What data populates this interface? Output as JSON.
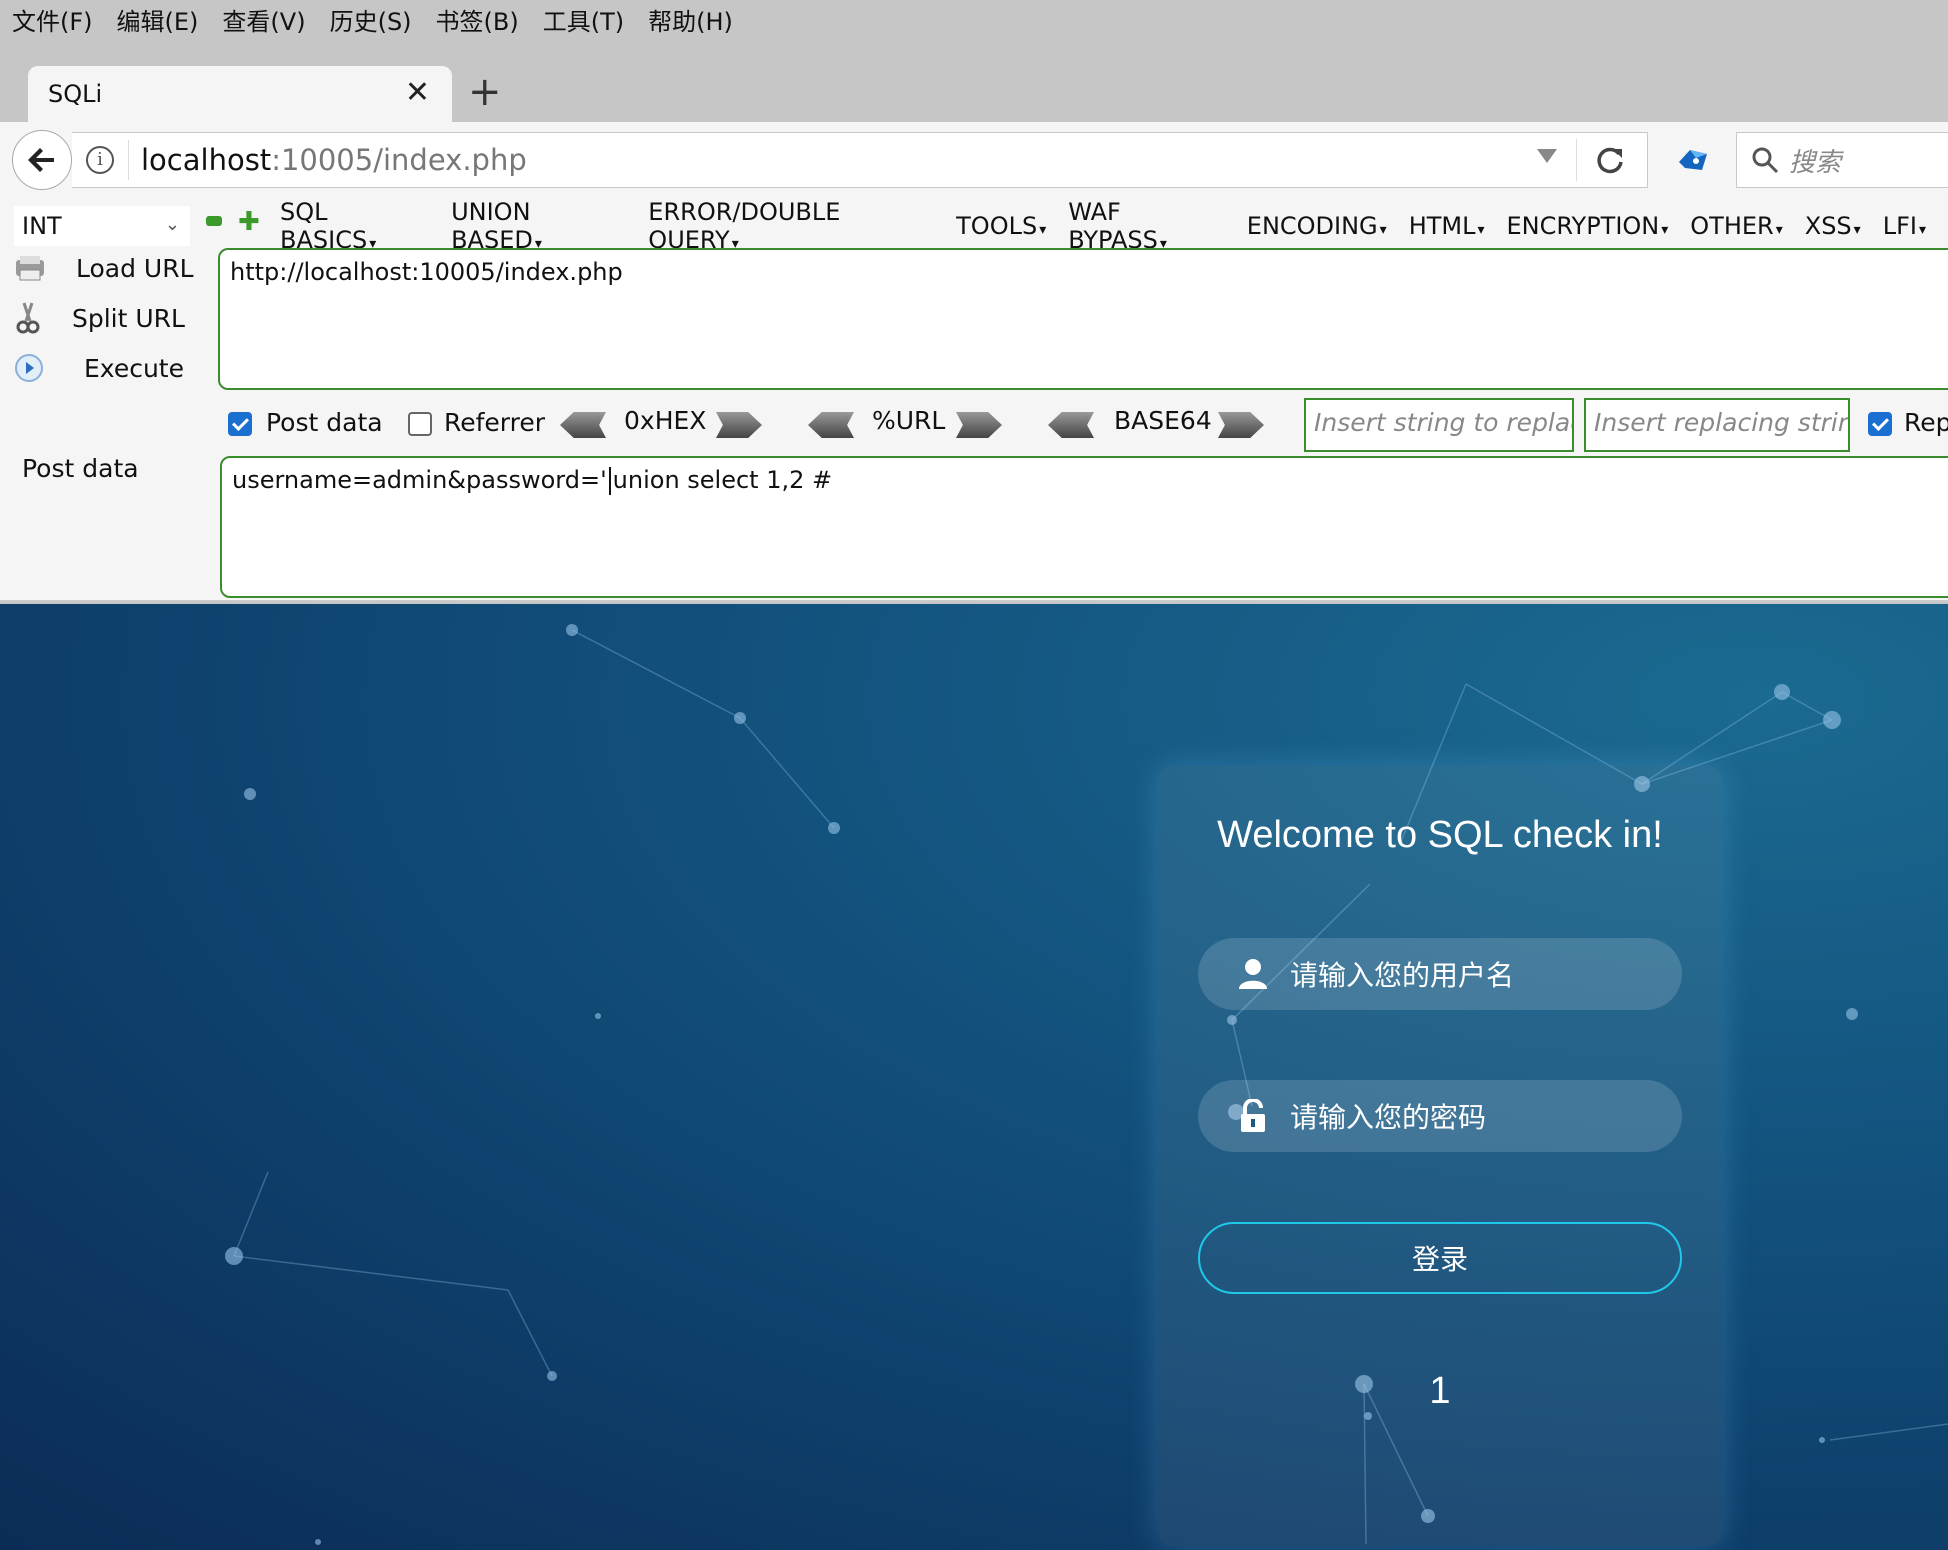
{
  "menubar": {
    "items": [
      "文件(F)",
      "编辑(E)",
      "查看(V)",
      "历史(S)",
      "书签(B)",
      "工具(T)",
      "帮助(H)"
    ]
  },
  "tab": {
    "title": "SQLi",
    "close": "✕",
    "new_tab": "+"
  },
  "navbar": {
    "url_host": "localhost",
    "url_rest": ":10005/index.php",
    "search_placeholder": "搜索"
  },
  "hackbar": {
    "type_select": "INT",
    "menus": [
      "SQL BASICS",
      "UNION BASED",
      "ERROR/DOUBLE QUERY",
      "TOOLS",
      "WAF BYPASS",
      "ENCODING",
      "HTML",
      "ENCRYPTION",
      "OTHER",
      "XSS",
      "LFI"
    ],
    "load_url": "Load URL",
    "split_url": "Split URL",
    "execute": "Execute",
    "url_value": "http://localhost:10005/index.php",
    "post_data_checkbox": {
      "label": "Post data",
      "checked": true
    },
    "referrer_checkbox": {
      "label": "Referrer",
      "checked": false
    },
    "encoders": [
      "0xHEX",
      "%URL",
      "BASE64"
    ],
    "replace_placeholder": "Insert string to replace",
    "replacing_placeholder": "Insert replacing string",
    "replace_all_label": "Rep",
    "replace_all_checked": true,
    "post_data_label": "Post data",
    "post_value_before": "username=admin&password='",
    "post_value_after": "union select 1,2 #"
  },
  "page": {
    "title": "Welcome to SQL check in!",
    "username_placeholder": "请输入您的用户名",
    "password_placeholder": "请输入您的密码",
    "login_label": "登录",
    "result": "1"
  },
  "colors": {
    "hackbar_border": "#3a8d2c",
    "checkbox_on": "#1a6fd0",
    "login_border": "#1fc8e8",
    "page_bg": "#0e3e6a"
  },
  "icons": [
    "back-arrow-icon",
    "info-icon",
    "dropdown-icon",
    "reload-icon",
    "extension-icon",
    "search-icon",
    "load-url-icon",
    "split-url-icon",
    "execute-icon",
    "user-icon",
    "lock-icon"
  ]
}
